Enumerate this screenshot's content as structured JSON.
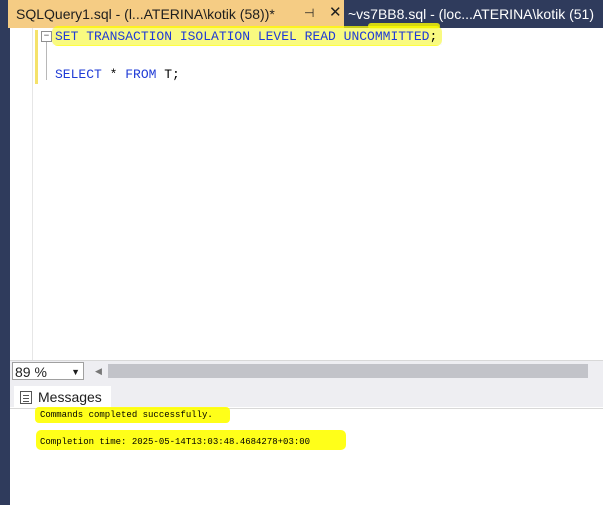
{
  "tabs": {
    "active": {
      "title": "SQLQuery1.sql - (l...ATERINA\\kotik (58))*",
      "pin_icon": "pin-icon",
      "close_icon": "close-icon"
    },
    "inactive": {
      "title": "~vs7BB8.sql - (loc...ATERINA\\kotik (51)"
    }
  },
  "editor": {
    "lines": [
      {
        "keyword": "SET TRANSACTION ISOLATION LEVEL READ UNCOMMITTED",
        "rest": ";"
      },
      {
        "keyword": "SELECT",
        "rest": " * ",
        "keyword2": "FROM",
        "rest2": " T;"
      }
    ],
    "collapse_glyph": "−",
    "highlight_color": "#ffff00"
  },
  "status": {
    "zoom": "89 %"
  },
  "results": {
    "tab_label": "Messages",
    "messages": [
      "Commands completed successfully.",
      "Completion time: 2025-05-14T13:03:48.4684278+03:00"
    ]
  },
  "colors": {
    "tabbar": "#2f3b5c",
    "active_tab": "#f5cc84",
    "keyword": "#1f3bd6"
  }
}
